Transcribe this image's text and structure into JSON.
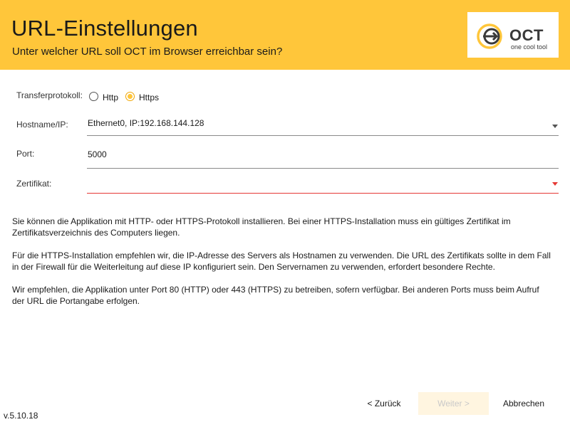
{
  "header": {
    "title": "URL-Einstellungen",
    "subtitle": "Unter welcher URL soll OCT im Browser erreichbar sein?",
    "background": "#ffc63a"
  },
  "logo": {
    "name": "OCT",
    "tagline": "one cool tool"
  },
  "form": {
    "protocol": {
      "label": "Transferprotokoll:",
      "options": [
        "Http",
        "Https"
      ],
      "selected": "Https"
    },
    "hostname": {
      "label": "Hostname/IP:",
      "value": "Ethernet0, IP:192.168.144.128"
    },
    "port": {
      "label": "Port:",
      "value": "5000"
    },
    "certificate": {
      "label": "Zertifikat:",
      "value": "",
      "error_color": "#e53935"
    }
  },
  "info": {
    "paragraphs": [
      "Sie können die Applikation mit HTTP- oder HTTPS-Protokoll installieren. Bei einer HTTPS-Installation muss ein gültiges Zertifikat im Zertifikatsverzeichnis des Computers liegen.",
      "Für die HTTPS-Installation empfehlen wir, die IP-Adresse des Servers als Hostnamen zu verwenden. Die URL des Zertifikats sollte in dem Fall in der Firewall für die Weiterleitung auf diese IP konfiguriert sein. Den Servernamen zu verwenden, erfordert besondere Rechte.",
      "Wir empfehlen, die Applikation unter Port 80 (HTTP) oder 443 (HTTPS) zu betreiben, sofern verfügbar. Bei anderen Ports muss beim Aufruf der URL die Portangabe erfolgen."
    ]
  },
  "footer": {
    "back_label": "< Zurück",
    "next_label": "Weiter >",
    "next_enabled": false,
    "cancel_label": "Abbrechen",
    "version": "v.5.10.18"
  }
}
